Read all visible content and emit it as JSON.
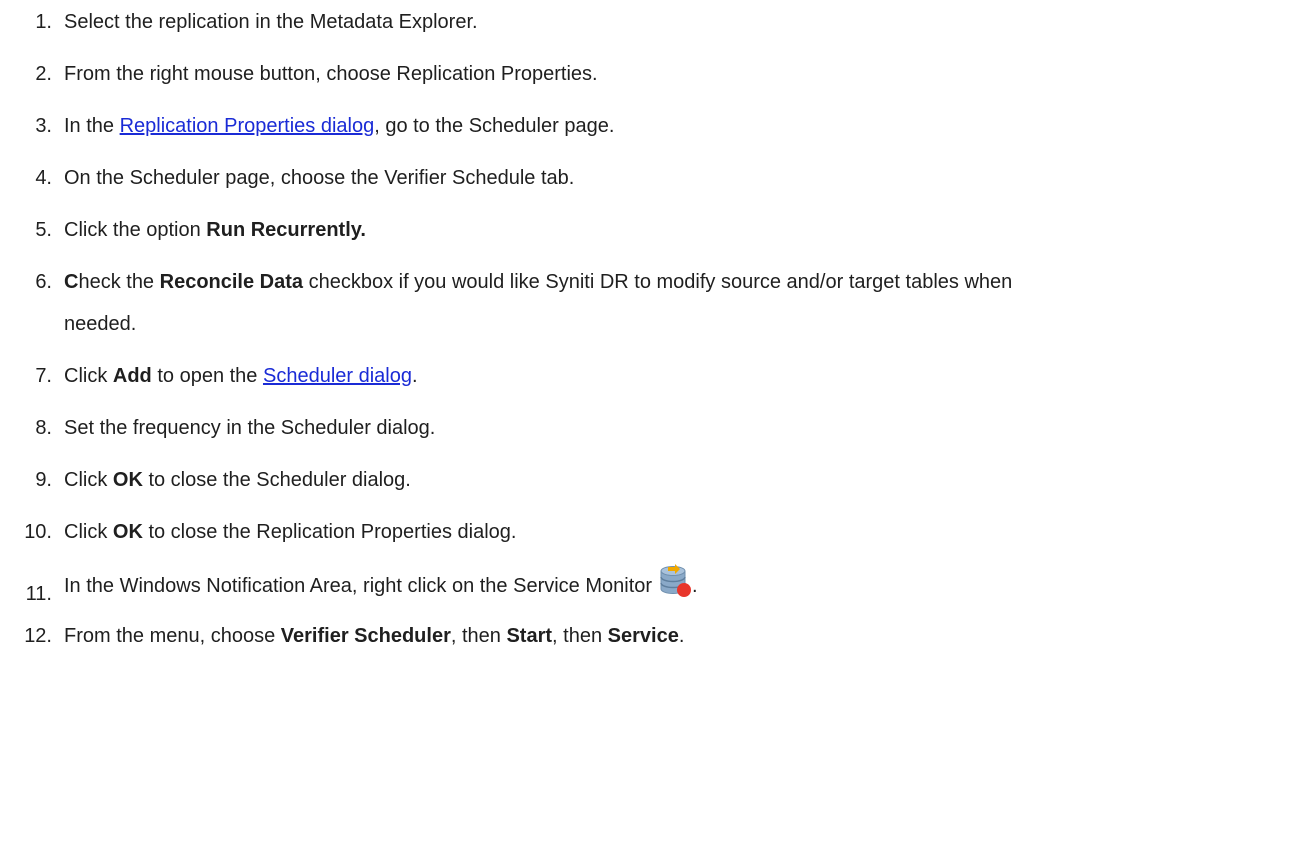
{
  "steps": [
    {
      "num": "1.",
      "parts": [
        "Select the replication in the Metadata Explorer."
      ]
    },
    {
      "num": "2.",
      "parts": [
        "From the right mouse button, choose Replication Properties."
      ]
    },
    {
      "num": "3.",
      "before": "In the ",
      "link": "Replication Properties dialog",
      "after": ", go to the Scheduler page."
    },
    {
      "num": "4.",
      "parts": [
        "On the Scheduler page, choose the Verifier Schedule tab."
      ]
    },
    {
      "num": "5.",
      "before": "Click the option ",
      "bold": "Run Recurrently."
    },
    {
      "num": "6.",
      "bold1": "C",
      "mid1": "heck the ",
      "bold2": "Reconcile Data",
      "mid2": " checkbox if you would like Syniti DR to modify source and/or target tables when",
      "line2": "needed."
    },
    {
      "num": "7.",
      "before": "Click ",
      "bold": "Add",
      "mid": " to open the ",
      "link": "Scheduler dialog",
      "after": "."
    },
    {
      "num": "8.",
      "parts": [
        "Set the frequency in the Scheduler dialog."
      ]
    },
    {
      "num": "9.",
      "before": "Click ",
      "bold": "OK",
      "after": " to close the Scheduler dialog."
    },
    {
      "num": "10.",
      "before": "Click ",
      "bold": "OK",
      "after": " to close the Replication Properties dialog."
    },
    {
      "num": "11.",
      "before": "In the Windows Notification Area, right click on the Service Monitor",
      "after": ".",
      "icon": "service-monitor-icon"
    },
    {
      "num": "12.",
      "before": "From the menu, choose  ",
      "bold": "Verifier Scheduler",
      "mid": ", then ",
      "bold2": "Start",
      "mid2": ", then ",
      "bold3": "Service",
      "after": "."
    }
  ],
  "colors": {
    "text": "#1f1f1f",
    "link": "#1a2bd6",
    "icon_db": "#8aa9c8",
    "icon_arrow": "#f0a800",
    "icon_badge": "#e8362c"
  }
}
